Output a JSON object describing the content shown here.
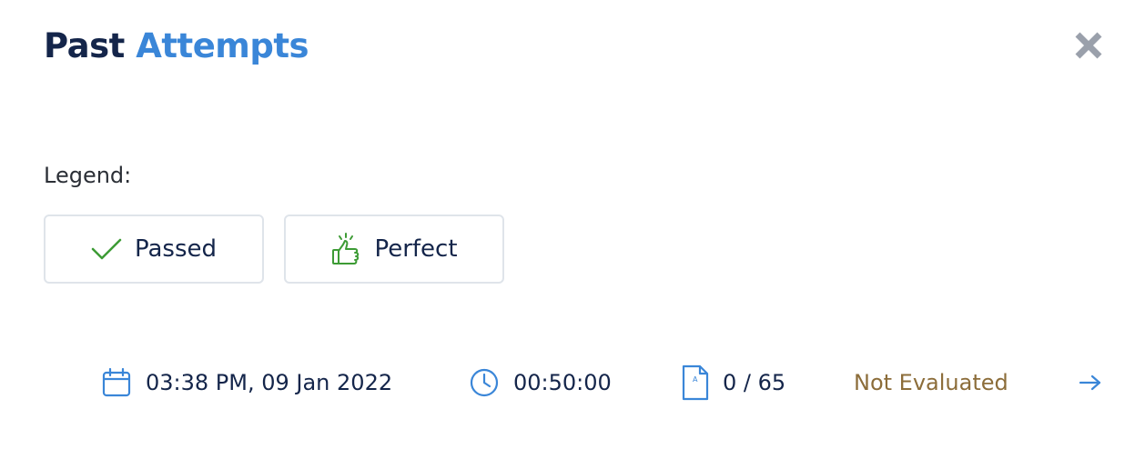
{
  "header": {
    "title_part1": "Past",
    "title_part2": "Attempts"
  },
  "legend": {
    "label": "Legend:",
    "items": [
      {
        "label": "Passed",
        "icon": "checkmark-icon",
        "color": "#3d9b35"
      },
      {
        "label": "Perfect",
        "icon": "thumbs-up-icon",
        "color": "#3d9b35"
      }
    ]
  },
  "attempt": {
    "datetime": "03:38 PM, 09 Jan 2022",
    "duration": "00:50:00",
    "score": "0 / 65",
    "status": "Not Evaluated",
    "status_color": "#8c6d3a"
  },
  "colors": {
    "accent": "#3a86d8",
    "navy": "#14254a",
    "close_icon": "#9aa0ab"
  }
}
